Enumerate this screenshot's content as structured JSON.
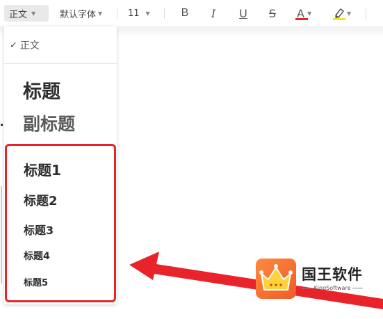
{
  "toolbar": {
    "style_value": "正文",
    "font_value": "默认字体",
    "size_value": "11",
    "bold_label": "B",
    "italic_label": "I",
    "underline_label": "U",
    "strike_label": "S",
    "font_color_label": "A",
    "font_color": "#e8242a",
    "highlight_color": "#f5e51f"
  },
  "style_menu": {
    "check_mark": "✓",
    "items": [
      {
        "label": "正文",
        "selected": true
      },
      {
        "label": "标题"
      },
      {
        "label": "副标题"
      },
      {
        "label": "标题1"
      },
      {
        "label": "标题2"
      },
      {
        "label": "标题3"
      },
      {
        "label": "标题4"
      },
      {
        "label": "标题5"
      }
    ]
  },
  "annotation": {
    "box_color": "#e8242a",
    "arrow_color": "#e8242a"
  },
  "watermark": {
    "title": "国王软件",
    "subtitle": "KingSoftware"
  }
}
